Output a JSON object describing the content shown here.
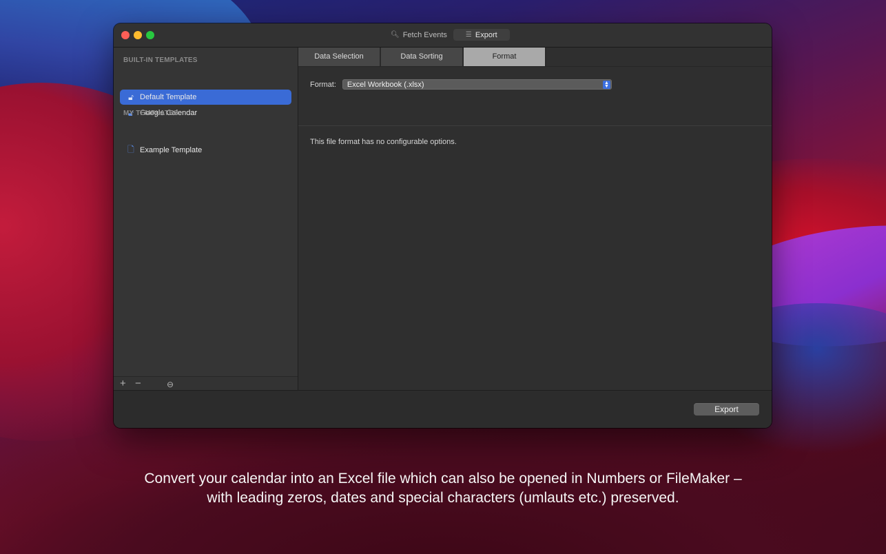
{
  "titlebar": {
    "segments": [
      {
        "label": "Fetch Events",
        "icon": "magnifier-icon"
      },
      {
        "label": "Export",
        "icon": "list-icon"
      }
    ]
  },
  "sidebar": {
    "builtin_header": "BUILT-IN TEMPLATES",
    "builtin_items": [
      {
        "label": "Default Template",
        "icon": "lock-icon",
        "selected": true
      },
      {
        "label": "Google Calendar",
        "icon": "lock-icon",
        "selected": false
      }
    ],
    "my_header": "MY TEMPLATES",
    "my_items": [
      {
        "label": "Example Template",
        "icon": "document-icon"
      }
    ],
    "toolbar": {
      "add": "+",
      "remove": "−",
      "more": "⊖"
    }
  },
  "tabs": [
    {
      "label": "Data Selection",
      "active": false
    },
    {
      "label": "Data Sorting",
      "active": false
    },
    {
      "label": "Format",
      "active": true
    }
  ],
  "format": {
    "label": "Format:",
    "value": "Excel Workbook (.xlsx)",
    "info": "This file format has no configurable options."
  },
  "footer": {
    "export_label": "Export"
  },
  "caption": {
    "line1": "Convert your calendar into an Excel file which can also be opened in Numbers or FileMaker –",
    "line2": "with leading zeros, dates and special characters (umlauts etc.) preserved."
  },
  "colors": {
    "accent": "#3a6bd6",
    "close": "#fe5f57",
    "minimize": "#febc2e",
    "maximize": "#28c840"
  }
}
